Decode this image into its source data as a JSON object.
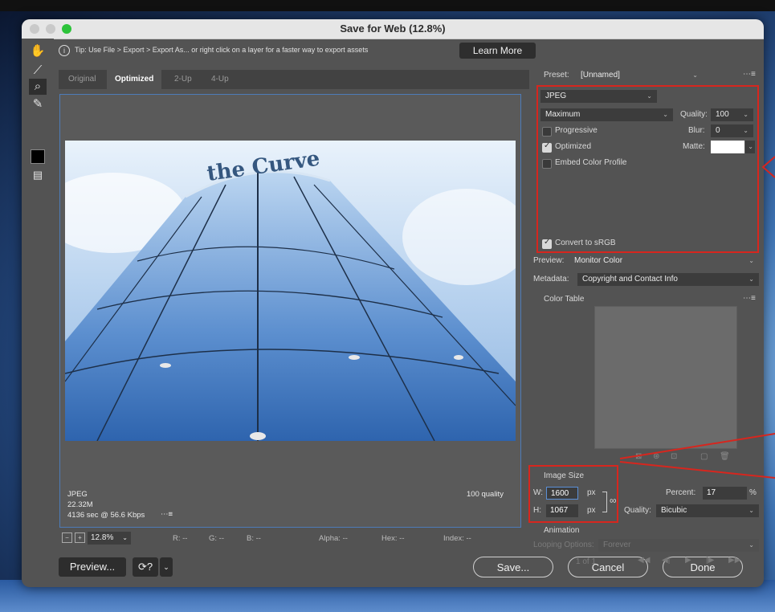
{
  "window": {
    "title": "Save for Web (12.8%)"
  },
  "tip": {
    "text": "Tip: Use File > Export > Export As... or right click on a layer for a faster way to export assets",
    "learn_more": "Learn More"
  },
  "view_tabs": [
    "Original",
    "Optimized",
    "2-Up",
    "4-Up"
  ],
  "preview_info": {
    "format": "JPEG",
    "size": "22.32M",
    "time": "4136 sec @ 56.6 Kbps",
    "quality": "100 quality"
  },
  "status": {
    "zoom": "12.8%",
    "r": "R: --",
    "g": "G: --",
    "b": "B: --",
    "alpha": "Alpha: --",
    "hex": "Hex: --",
    "index": "Index: --"
  },
  "bottom": {
    "preview": "Preview...",
    "save": "Save...",
    "cancel": "Cancel",
    "done": "Done"
  },
  "settings": {
    "preset_label": "Preset:",
    "preset_value": "[Unnamed]",
    "format": "JPEG",
    "compression": "Maximum",
    "quality_label": "Quality:",
    "quality_value": "100",
    "blur_label": "Blur:",
    "blur_value": "0",
    "matte_label": "Matte:",
    "progressive": "Progressive",
    "optimized": "Optimized",
    "embed_profile": "Embed Color Profile",
    "convert_srgb": "Convert to sRGB",
    "preview_label": "Preview:",
    "preview_value": "Monitor Color",
    "metadata_label": "Metadata:",
    "metadata_value": "Copyright and Contact Info",
    "color_table": "Color Table"
  },
  "image_size": {
    "header": "Image Size",
    "w_label": "W:",
    "w_value": "1600",
    "h_label": "H:",
    "h_value": "1067",
    "unit": "px",
    "percent_label": "Percent:",
    "percent_value": "17",
    "percent_unit": "%",
    "quality_label": "Quality:",
    "quality_value": "Bicubic"
  },
  "animation": {
    "header": "Animation",
    "looping_label": "Looping Options:",
    "looping_value": "Forever",
    "frame": "1 of 1"
  },
  "photo_text": "the Curve",
  "colors": {
    "accent_red": "#d7261e",
    "preview_border": "#4d7bb8"
  }
}
